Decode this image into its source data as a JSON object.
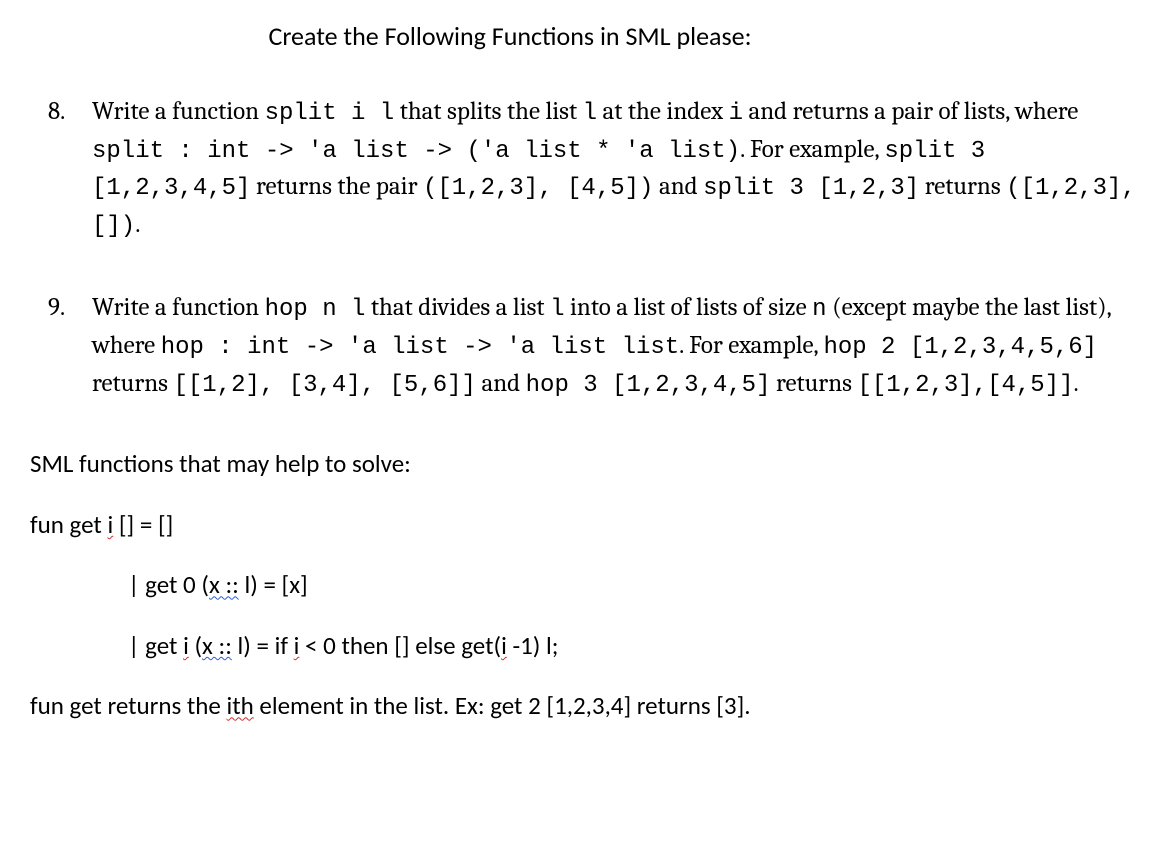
{
  "title": "Create the Following Functions in SML please:",
  "questions": [
    {
      "number": "8.",
      "text_parts": [
        {
          "t": "Write a function ",
          "c": false
        },
        {
          "t": "split i l",
          "c": true
        },
        {
          "t": " that splits the list ",
          "c": false
        },
        {
          "t": "l",
          "c": true
        },
        {
          "t": " at the index ",
          "c": false
        },
        {
          "t": "i",
          "c": true
        },
        {
          "t": " and returns a pair of lists, where ",
          "c": false
        },
        {
          "t": "split : int -> 'a list -> ('a list * 'a list)",
          "c": true
        },
        {
          "t": ". For example, ",
          "c": false
        },
        {
          "t": "split 3 [1,2,3,4,5]",
          "c": true
        },
        {
          "t": " returns the pair ",
          "c": false
        },
        {
          "t": "([1,2,3], [4,5])",
          "c": true
        },
        {
          "t": " and ",
          "c": false
        },
        {
          "t": "split 3 [1,2,3]",
          "c": true
        },
        {
          "t": " returns ",
          "c": false
        },
        {
          "t": "([1,2,3], [])",
          "c": true
        },
        {
          "t": ".",
          "c": false
        }
      ]
    },
    {
      "number": "9.",
      "text_parts": [
        {
          "t": "Write a function ",
          "c": false
        },
        {
          "t": "hop n l",
          "c": true
        },
        {
          "t": " that divides a list ",
          "c": false
        },
        {
          "t": "l",
          "c": true
        },
        {
          "t": " into a list of lists of size ",
          "c": false
        },
        {
          "t": "n",
          "c": true
        },
        {
          "t": " (except maybe the last list), where ",
          "c": false
        },
        {
          "t": "hop : int -> 'a list -> 'a list list",
          "c": true
        },
        {
          "t": ". For example, ",
          "c": false
        },
        {
          "t": "hop 2 [1,2,3,4,5,6]",
          "c": true
        },
        {
          "t": " returns ",
          "c": false
        },
        {
          "t": "[[1,2], [3,4], [5,6]]",
          "c": true
        },
        {
          "t": " and ",
          "c": false
        },
        {
          "t": "hop 3 [1,2,3,4,5]",
          "c": true
        },
        {
          "t": " returns ",
          "c": false
        },
        {
          "t": "[[1,2,3],[4,5]]",
          "c": true
        },
        {
          "t": ".",
          "c": false
        }
      ]
    }
  ],
  "helper_title": "SML functions that may help to solve:",
  "fun_lines": {
    "l1a": "fun get ",
    "l1_i": "i",
    "l1b": " [] = []",
    "l2a": "| get 0 (",
    "l2_x": "x ::",
    "l2b": " l) = [x]",
    "l3a": "| get ",
    "l3_i1": "i",
    "l3b": " (",
    "l3_x": "x ::",
    "l3c": " l) = if ",
    "l3_i2": "i",
    "l3d": " < 0 then [] else get(",
    "l3_i3": "i",
    "l3e": " -1) l;"
  },
  "closing": {
    "a": "fun get returns the ",
    "ith": "ith",
    "b": " element in the list. Ex: get 2 [1,2,3,4] returns [3]."
  }
}
